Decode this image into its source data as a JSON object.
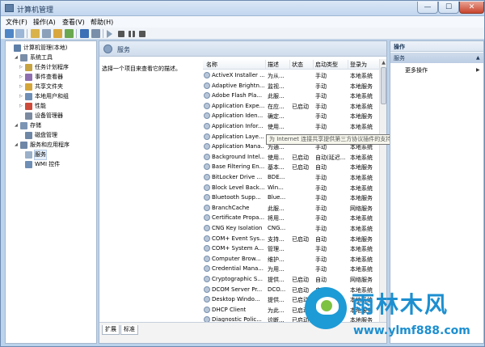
{
  "window": {
    "title": "计算机管理"
  },
  "menu": [
    "文件(F)",
    "操作(A)",
    "查看(V)",
    "帮助(H)"
  ],
  "tree": {
    "items": [
      {
        "label": "计算机管理(本地)",
        "icon": "computer-icon",
        "level": 0,
        "expander": ""
      },
      {
        "label": "系统工具",
        "icon": "tools-icon",
        "level": 1,
        "expander": "◢"
      },
      {
        "label": "任务计划程序",
        "icon": "clock-icon",
        "level": 2,
        "expander": "▷"
      },
      {
        "label": "事件查看器",
        "icon": "event-icon",
        "level": 2,
        "expander": "▷"
      },
      {
        "label": "共享文件夹",
        "icon": "folder-icon",
        "level": 2,
        "expander": "▷"
      },
      {
        "label": "本地用户和组",
        "icon": "users-icon",
        "level": 2,
        "expander": "▷"
      },
      {
        "label": "性能",
        "icon": "perf-icon",
        "level": 2,
        "expander": "▷"
      },
      {
        "label": "设备管理器",
        "icon": "device-icon",
        "level": 2,
        "expander": ""
      },
      {
        "label": "存储",
        "icon": "storage-icon",
        "level": 1,
        "expander": "◢"
      },
      {
        "label": "磁盘管理",
        "icon": "disk-icon",
        "level": 2,
        "expander": ""
      },
      {
        "label": "服务和应用程序",
        "icon": "services-apps-icon",
        "level": 1,
        "expander": "◢"
      },
      {
        "label": "服务",
        "icon": "services-icon",
        "level": 2,
        "expander": ""
      },
      {
        "label": "WMI 控件",
        "icon": "wmi-icon",
        "level": 2,
        "expander": ""
      }
    ]
  },
  "middle": {
    "header": "服务",
    "description": "选择一个项目来查看它的描述。",
    "columns": [
      "名称",
      "描述",
      "状态",
      "启动类型",
      "登录为"
    ],
    "rows": [
      [
        "ActiveX Installer ...",
        "为从...",
        "",
        "手动",
        "本地系统"
      ],
      [
        "Adaptive Brightn...",
        "监视...",
        "",
        "手动",
        "本地服务"
      ],
      [
        "Adobe Flash Pla...",
        "此服...",
        "",
        "手动",
        "本地系统"
      ],
      [
        "Application Expe...",
        "在应...",
        "已启动",
        "手动",
        "本地系统"
      ],
      [
        "Application Iden...",
        "确定...",
        "",
        "手动",
        "本地服务"
      ],
      [
        "Application Infor...",
        "使用...",
        "",
        "手动",
        "本地系统"
      ],
      [
        "Application Laye...",
        "",
        "",
        "",
        ""
      ],
      [
        "Application Mana...",
        "为通...",
        "",
        "手动",
        "本地系统"
      ],
      [
        "Background Intel...",
        "使用...",
        "已启动",
        "自动(延迟...",
        "本地系统"
      ],
      [
        "Base Filtering En...",
        "基本...",
        "已启动",
        "自动",
        "本地服务"
      ],
      [
        "BitLocker Drive ...",
        "BDE...",
        "",
        "手动",
        "本地系统"
      ],
      [
        "Block Level Back...",
        "Win...",
        "",
        "手动",
        "本地系统"
      ],
      [
        "Bluetooth Supp...",
        "Blue...",
        "",
        "手动",
        "本地服务"
      ],
      [
        "BranchCache",
        "此服...",
        "",
        "手动",
        "网络服务"
      ],
      [
        "Certificate Propa...",
        "将用...",
        "",
        "手动",
        "本地系统"
      ],
      [
        "CNG Key Isolation",
        "CNG...",
        "",
        "手动",
        "本地系统"
      ],
      [
        "COM+ Event Sys...",
        "支持...",
        "已启动",
        "自动",
        "本地服务"
      ],
      [
        "COM+ System A...",
        "管理...",
        "",
        "手动",
        "本地系统"
      ],
      [
        "Computer Brow...",
        "维护...",
        "",
        "手动",
        "本地系统"
      ],
      [
        "Credential Mana...",
        "为用...",
        "",
        "手动",
        "本地系统"
      ],
      [
        "Cryptographic S...",
        "提供...",
        "已启动",
        "自动",
        "网络服务"
      ],
      [
        "DCOM Server Pr...",
        "DCO...",
        "已启动",
        "自动",
        "本地系统"
      ],
      [
        "Desktop Windo...",
        "提供...",
        "已启动",
        "自动",
        "本地系统"
      ],
      [
        "DHCP Client",
        "为此...",
        "已启动",
        "自动",
        "本地服务"
      ],
      [
        "Diagnostic Polic...",
        "诊断...",
        "已启动",
        "自动",
        "本地服务"
      ]
    ],
    "tooltip": "为 Internet 连接共享提供第三方协议插件的支持",
    "tabs": [
      "扩展",
      "标准"
    ]
  },
  "actions": {
    "header": "操作",
    "section": "服务",
    "more": "更多操作"
  },
  "watermark": {
    "brand": "雨林木风",
    "url": "www.ylmf888.com"
  }
}
